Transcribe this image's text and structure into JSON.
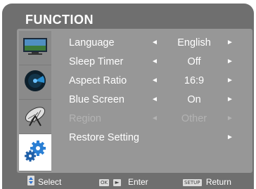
{
  "title": "FUNCTION",
  "sidebar": {
    "tabs": [
      {
        "icon": "tv-picture-icon",
        "active": false
      },
      {
        "icon": "sound-icon",
        "active": false
      },
      {
        "icon": "satellite-dish-icon",
        "active": false
      },
      {
        "icon": "gears-icon",
        "active": true
      }
    ]
  },
  "menu": {
    "items": [
      {
        "label": "Language",
        "value": "English",
        "left_arrow": "◄",
        "right_arrow": "►",
        "enabled": true
      },
      {
        "label": "Sleep Timer",
        "value": "Off",
        "left_arrow": "◄",
        "right_arrow": "►",
        "enabled": true
      },
      {
        "label": "Aspect Ratio",
        "value": "16:9",
        "left_arrow": "◄",
        "right_arrow": "►",
        "enabled": true
      },
      {
        "label": "Blue Screen",
        "value": "On",
        "left_arrow": "◄",
        "right_arrow": "►",
        "enabled": true
      },
      {
        "label": "Region",
        "value": "Other",
        "left_arrow": "◄",
        "right_arrow": "►",
        "enabled": false
      },
      {
        "label": "Restore Setting",
        "value": "",
        "left_arrow": "",
        "right_arrow": "►",
        "enabled": true
      }
    ]
  },
  "footer": {
    "select_label": "Select",
    "ok_key": "OK",
    "enter_label": "Enter",
    "setup_key": "SETUP",
    "return_label": "Return"
  },
  "colors": {
    "frame": "#6f6f6f",
    "panel": "#979797",
    "sidebar_tab": "#8a8a8a",
    "active_tab": "#ffffff",
    "text": "#ffffff",
    "disabled_text": "#b3b3b3"
  }
}
